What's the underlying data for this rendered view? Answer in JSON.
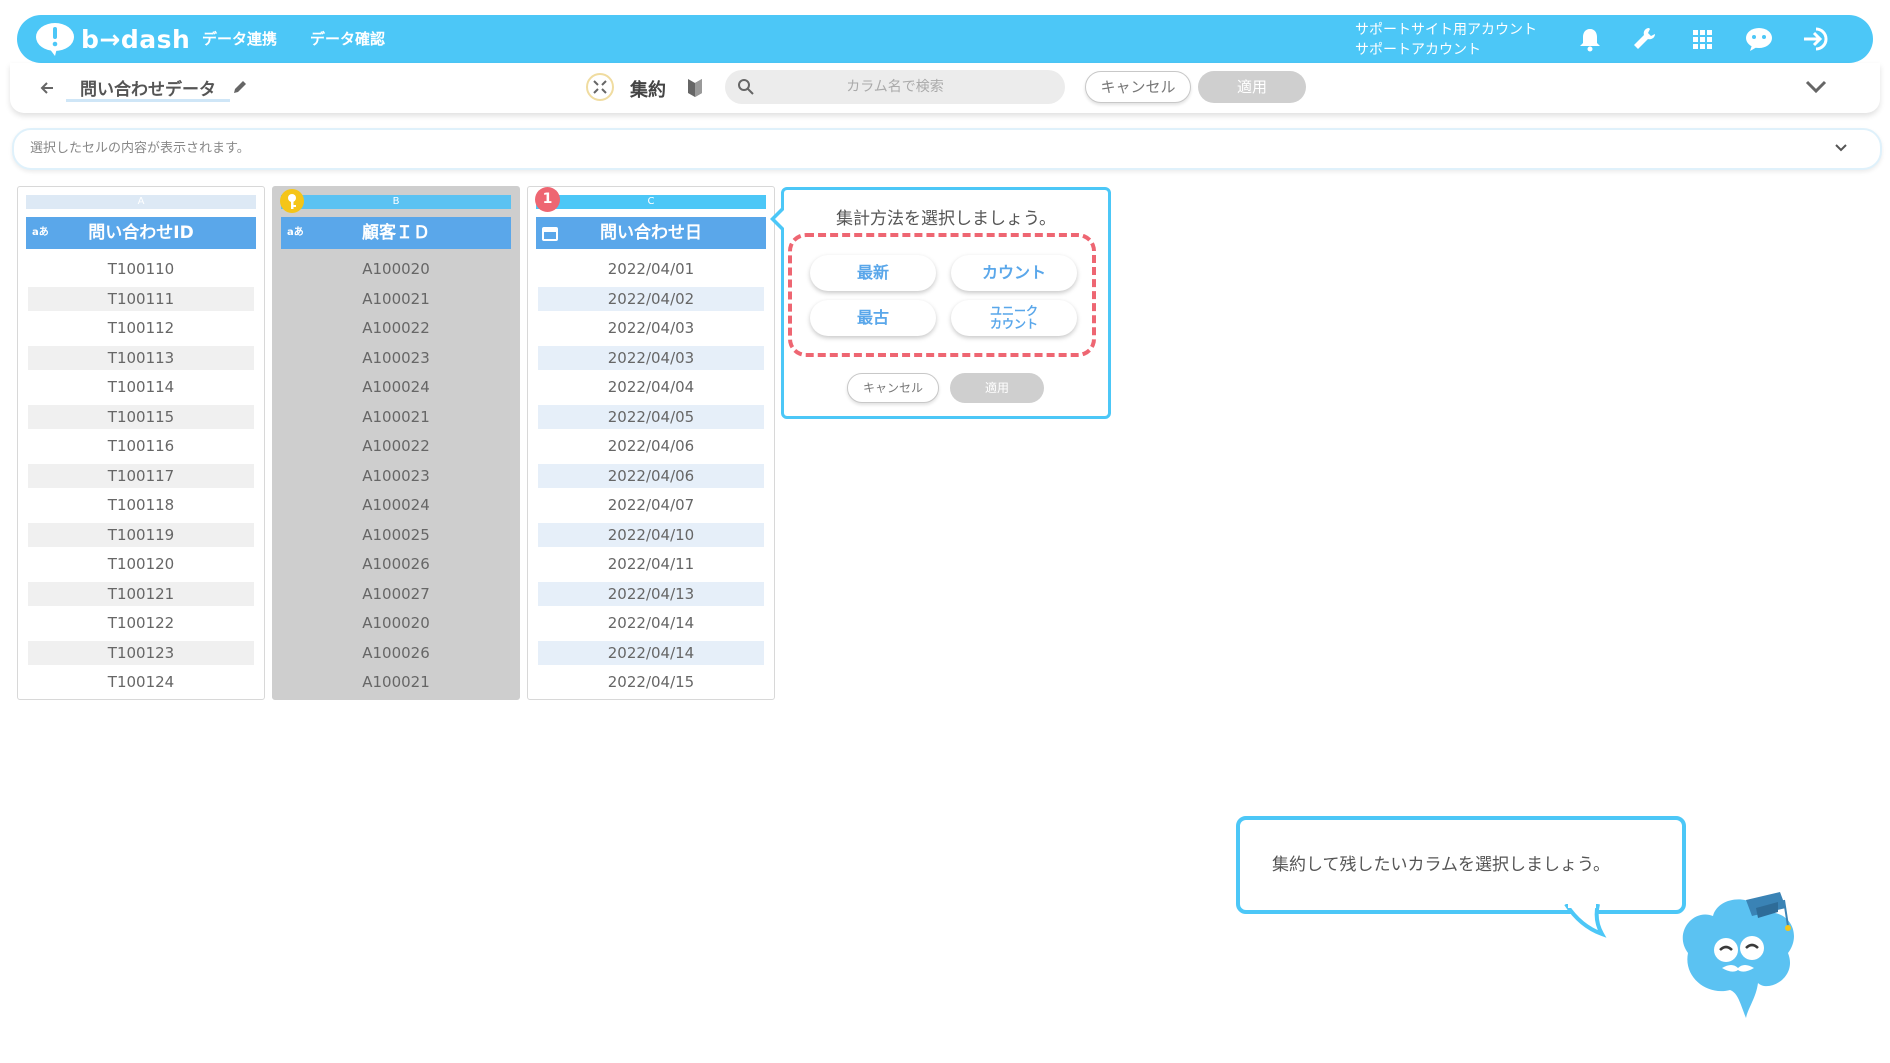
{
  "header": {
    "brand": "b→dash",
    "nav": [
      "データ連携",
      "データ確認"
    ],
    "account_line1": "サポートサイト用アカウント",
    "account_line2": "サポートアカウント",
    "icons": [
      "bell-icon",
      "wrench-icon",
      "grid-icon",
      "chat-bot-icon",
      "logout-icon"
    ],
    "accent_color": "#4cc7f7"
  },
  "toolbar": {
    "back_icon": "arrow-left-icon",
    "data_name": "問い合わせデータ",
    "edit_icon": "pencil-icon",
    "mode_icon": "collapse-icon",
    "mode_label": "集約",
    "beginner_icon": "beginner-mark-icon",
    "search_placeholder": "カラム名で検索",
    "cancel_label": "キャンセル",
    "apply_label": "適用",
    "expand_icon": "chevron-down-icon"
  },
  "info_bar": {
    "text": "選択したセルの内容が表示されます。"
  },
  "columns": [
    {
      "letter": "A",
      "type": "aあ",
      "name": "問い合わせID",
      "cells": [
        "T100110",
        "T100111",
        "T100112",
        "T100113",
        "T100114",
        "T100115",
        "T100116",
        "T100117",
        "T100118",
        "T100119",
        "T100120",
        "T100121",
        "T100122",
        "T100123",
        "T100124"
      ]
    },
    {
      "letter": "B",
      "type": "aあ",
      "name": "顧客ＩＤ",
      "key_icon": "key-icon",
      "cells": [
        "A100020",
        "A100021",
        "A100022",
        "A100023",
        "A100024",
        "A100021",
        "A100022",
        "A100023",
        "A100024",
        "A100025",
        "A100026",
        "A100027",
        "A100020",
        "A100026",
        "A100021"
      ]
    },
    {
      "letter": "C",
      "type": "calendar",
      "name": "問い合わせ日",
      "badge": "1",
      "cells": [
        "2022/04/01",
        "2022/04/02",
        "2022/04/03",
        "2022/04/03",
        "2022/04/04",
        "2022/04/05",
        "2022/04/06",
        "2022/04/06",
        "2022/04/07",
        "2022/04/10",
        "2022/04/11",
        "2022/04/13",
        "2022/04/14",
        "2022/04/14",
        "2022/04/15"
      ]
    }
  ],
  "aggregate_popup": {
    "title": "集計方法を選択しましょう。",
    "options": [
      "最新",
      "カウント",
      "最古",
      "ユニーク",
      "カウント"
    ],
    "cancel_label": "キャンセル",
    "apply_label": "適用"
  },
  "hint_bubble": {
    "text": "集約して残したいカラムを選択しましょう。"
  },
  "colors": {
    "header_bg": "#4cc7f7",
    "column_header": "#5aa7ea",
    "highlight_dash": "#ee6672",
    "key_badge": "#f5c518",
    "count_badge": "#ee6672"
  }
}
